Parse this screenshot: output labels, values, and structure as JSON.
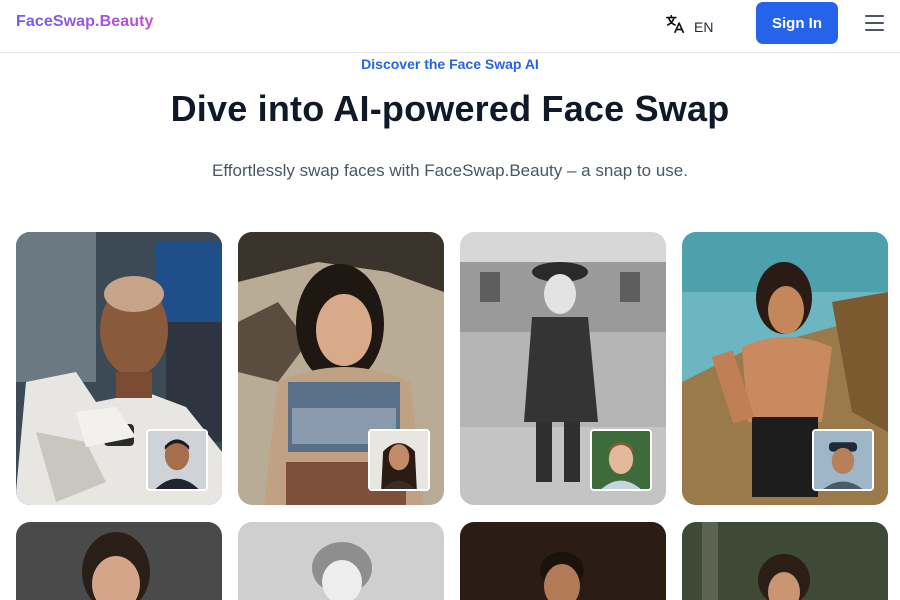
{
  "header": {
    "logo": "FaceSwap.Beauty",
    "language": {
      "icon": "translate-icon",
      "label": "EN"
    },
    "signin_label": "Sign In",
    "menu_icon": "hamburger-menu-icon"
  },
  "hero": {
    "eyebrow": "Discover the Face Swap AI",
    "title": "Dive into AI-powered Face Swap",
    "subtitle": "Effortlessly swap faces with FaceSwap.Beauty – a snap to use."
  },
  "colors": {
    "accent": "#2563eb",
    "logo_gradient_start": "#6d5ce8",
    "logo_gradient_end": "#c14fd4",
    "heading": "#111827",
    "body_text": "#4b5563"
  },
  "gallery": {
    "cards": [
      {
        "name": "astronaut-example"
      },
      {
        "name": "vintage-woman-example"
      },
      {
        "name": "boy-soldier-example"
      },
      {
        "name": "beach-man-example"
      },
      {
        "name": "studio-woman-example"
      },
      {
        "name": "vintage-girl-example"
      },
      {
        "name": "dark-portrait-man-example"
      },
      {
        "name": "forest-woman-example"
      }
    ]
  }
}
